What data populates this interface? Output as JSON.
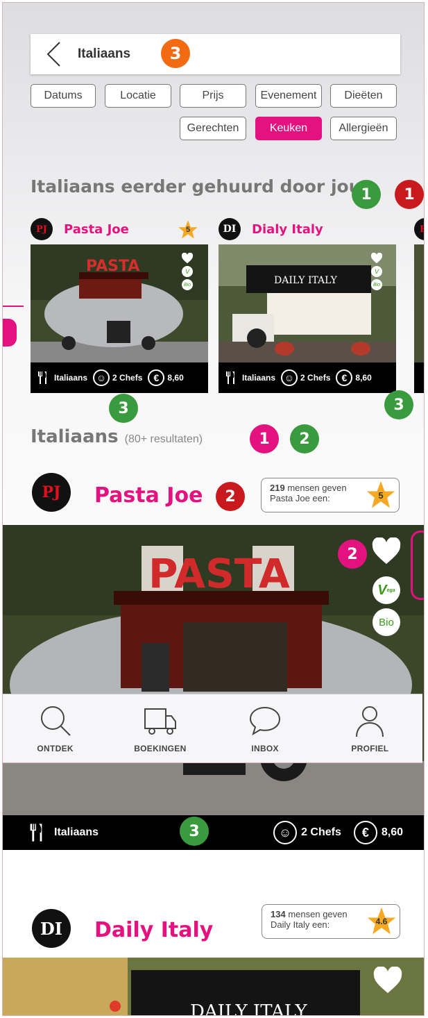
{
  "search": {
    "title": "Italiaans",
    "count_badge": "3"
  },
  "filters": {
    "row1": [
      "Datums",
      "Locatie",
      "Prijs",
      "Evenement",
      "Dieëten"
    ],
    "row2": [
      "Gerechten",
      "Keuken",
      "Allergieën"
    ],
    "active": "Keuken"
  },
  "recent": {
    "title": "Italiaans eerder gehuurd door jou",
    "badges": [
      "1",
      "1"
    ],
    "cards": [
      {
        "logo": "PJ",
        "name": "Pasta Joe",
        "rating": "5",
        "cuisine": "Italiaans",
        "chefs": "2 Chefs",
        "price": "8,60",
        "badge": "3"
      },
      {
        "logo": "DI",
        "name": "Dialy Italy",
        "rating": "",
        "cuisine": "Italiaans",
        "chefs": "2 Chefs",
        "price": "8,60",
        "badge": "3"
      }
    ],
    "third_logo": "PJ"
  },
  "results": {
    "title": "Italiaans",
    "count": "(80+ resultaten)",
    "badges": [
      "1",
      "2"
    ]
  },
  "vendors": [
    {
      "logo": "PJ",
      "name": "Pasta Joe",
      "badge": "2",
      "rating_count": "219",
      "rating_text": "mensen geven",
      "rating_text2": "Pasta Joe een:",
      "rating": "5",
      "heart_badge": "2",
      "vega": "V",
      "vega_sub": "ega",
      "bio": "Bio",
      "cuisine": "Italiaans",
      "chefs": "2 Chefs",
      "price": "8,60",
      "bar_badge": "3"
    },
    {
      "logo": "DI",
      "name": "Daily Italy",
      "rating_count": "134",
      "rating_text": "mensen geven",
      "rating_text2": "Daily Italy een:",
      "rating": "4.6"
    }
  ],
  "nav": [
    {
      "label": "ONTDEK",
      "icon": "search-icon"
    },
    {
      "label": "BOEKINGEN",
      "icon": "truck-icon"
    },
    {
      "label": "INBOX",
      "icon": "chat-icon"
    },
    {
      "label": "PROFIEL",
      "icon": "user-icon"
    }
  ],
  "colors": {
    "pink": "#e4127e",
    "green": "#3a9b3e",
    "red": "#c81a1e",
    "orange": "#f26a12",
    "star": "#f7a823"
  }
}
